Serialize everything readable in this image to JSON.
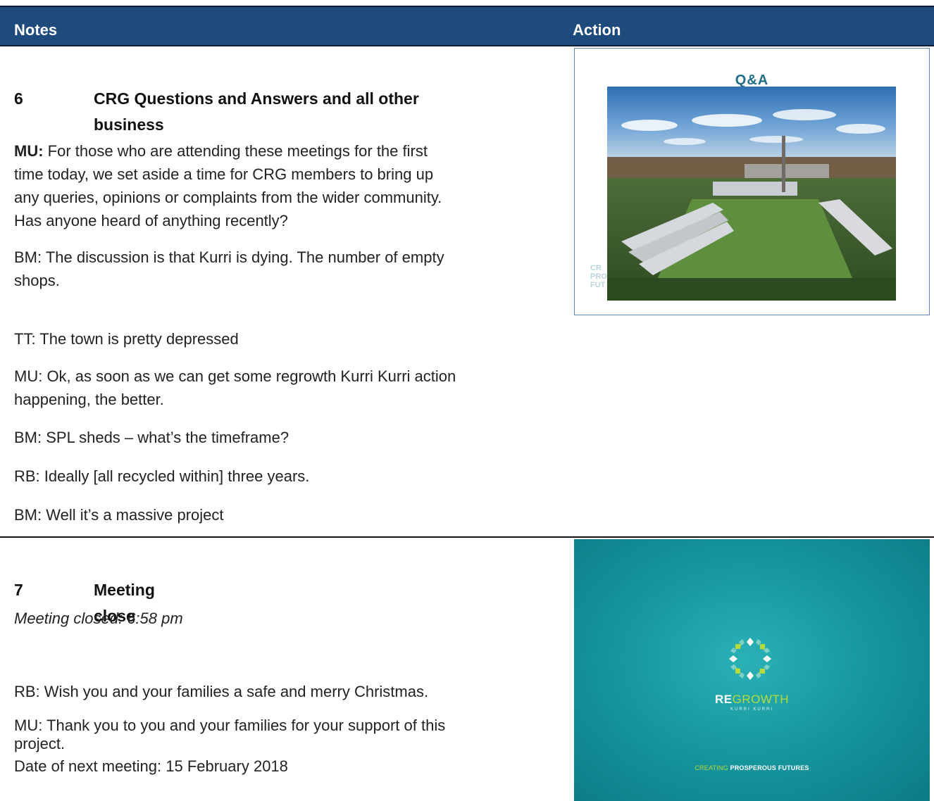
{
  "header": {
    "notes": "Notes",
    "action": "Action"
  },
  "section6": {
    "number": "6",
    "title_line1": "CRG Questions and Answers and all other",
    "title_line2": "business",
    "p1_speaker": "MU:",
    "p1_line1": " For those who are attending these meetings for the first",
    "p1_line2": "time today, we set aside a time for CRG members to bring up",
    "p1_line3": "any queries, opinions or complaints from the wider community.",
    "p1_line4": "Has anyone heard of anything recently?",
    "p2_line1": "BM: The discussion is that Kurri is dying. The number of empty",
    "p2_line2": "shops.",
    "p3": "TT: The town is pretty depressed",
    "p4_line1": "MU: Ok, as soon as we can get some regrowth Kurri Kurri action",
    "p4_line2": "happening, the better.",
    "p5": "BM: SPL sheds – what’s the timeframe?",
    "p6": "RB: Ideally [all recycled within] three years.",
    "p7": "BM: Well it’s a massive project"
  },
  "section7": {
    "number": "7",
    "title": "Meeting close",
    "closed": "Meeting closed: 6:58 pm",
    "p1": "RB: Wish you and your families a safe and merry Christmas.",
    "p2_line1": "MU: Thank you to you and your families for your support of this",
    "p2_line2": "project.",
    "p3": "Date of next meeting: 15 February 2018"
  },
  "slide_qa": {
    "title": "Q&A",
    "faded_line1": "CR",
    "faded_line2": "PRO",
    "faded_line3": "FUT"
  },
  "slide_brand": {
    "brand_re": "RE",
    "brand_growth": "GROWTH",
    "sub": "KURRI KURRI",
    "tag_a": "CREATING",
    "tag_b": " PROSPEROUS FUTURES"
  },
  "colors": {
    "header_bg": "#1f4a7c",
    "slide_teal": "#16969e",
    "brand_green": "#b6dc3c"
  }
}
